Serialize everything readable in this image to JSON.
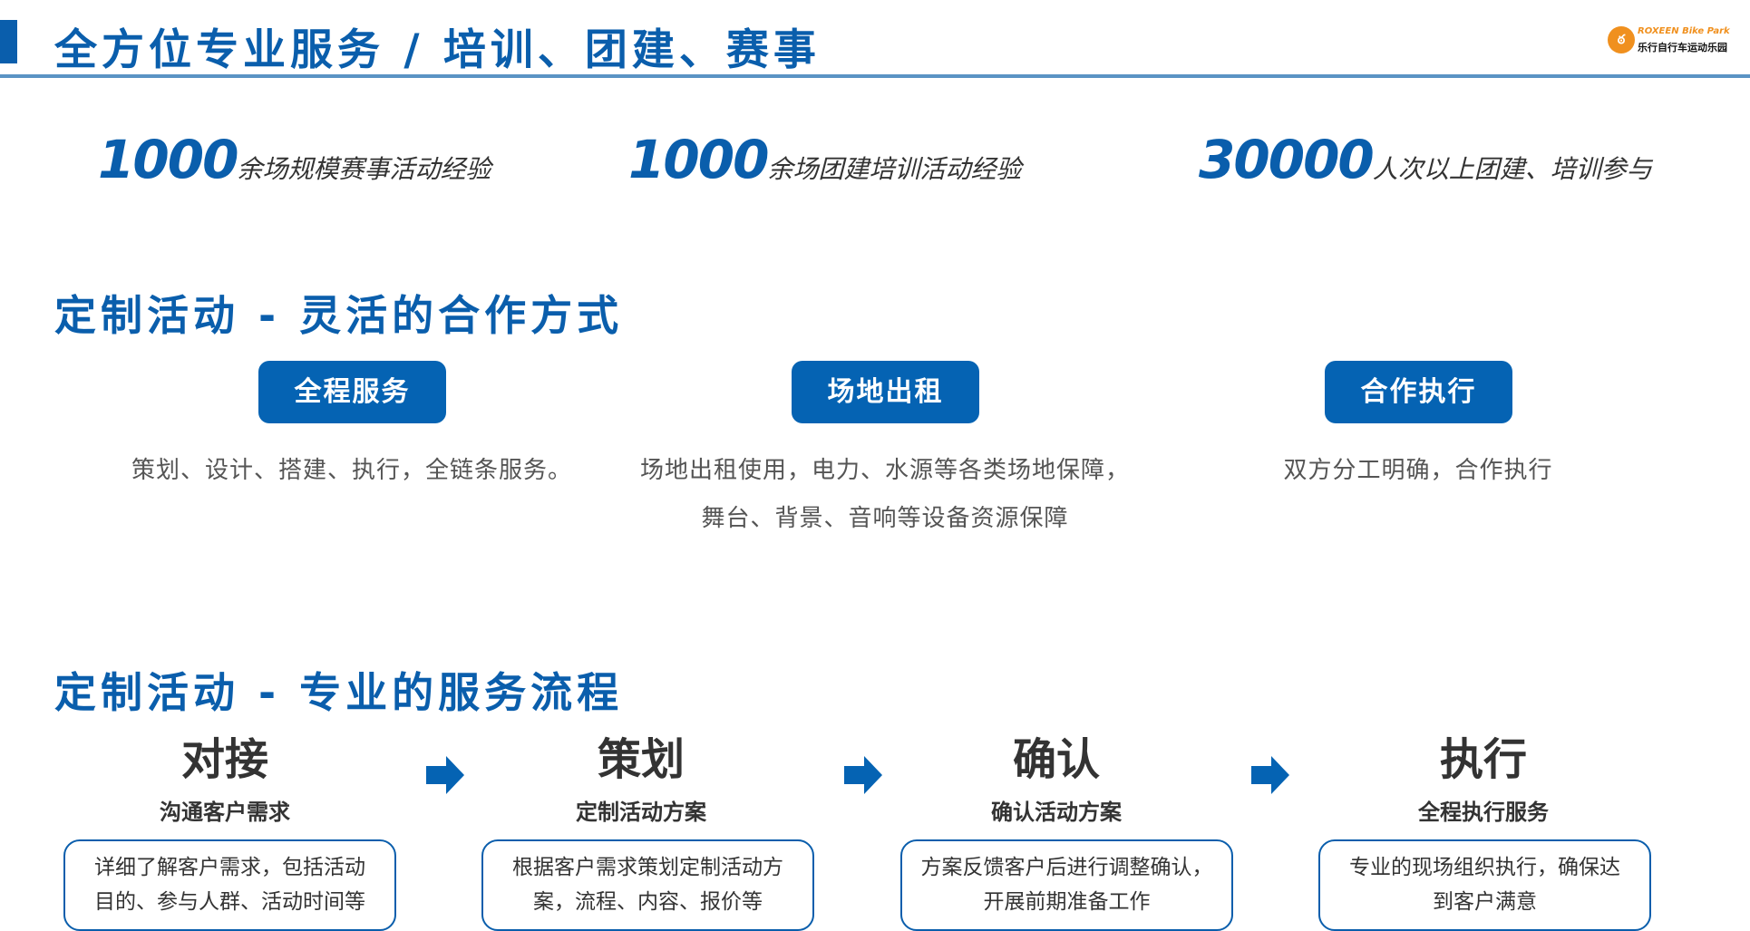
{
  "header": {
    "title": "全方位专业服务 / 培训、团建、赛事",
    "logo_en": "ROXEEN Bike Park",
    "logo_cn": "乐行自行车运动乐园"
  },
  "stats": [
    {
      "number": "1000",
      "label": "余场规模赛事活动经验"
    },
    {
      "number": "1000",
      "label": "余场团建培训活动经验"
    },
    {
      "number": "30000",
      "label": "人次以上团建、培训参与"
    }
  ],
  "cooperation": {
    "heading": "定制活动 - 灵活的合作方式",
    "items": [
      {
        "button": "全程服务",
        "desc": [
          "策划、设计、搭建、执行，全链条服务。"
        ]
      },
      {
        "button": "场地出租",
        "desc": [
          "场地出租使用，电力、水源等各类场地保障，",
          "舞台、背景、音响等设备资源保障"
        ]
      },
      {
        "button": "合作执行",
        "desc": [
          "双方分工明确，合作执行"
        ]
      }
    ]
  },
  "process": {
    "heading": "定制活动 - 专业的服务流程",
    "steps": [
      {
        "title": "对接",
        "subtitle": "沟通客户需求",
        "desc": [
          "详细了解客户需求，包括活动",
          "目的、参与人群、活动时间等"
        ]
      },
      {
        "title": "策划",
        "subtitle": "定制活动方案",
        "desc": [
          "根据客户需求策划定制活动方",
          "案，流程、内容、报价等"
        ]
      },
      {
        "title": "确认",
        "subtitle": "确认活动方案",
        "desc": [
          "方案反馈客户后进行调整确认，",
          "开展前期准备工作"
        ]
      },
      {
        "title": "执行",
        "subtitle": "全程执行服务",
        "desc": [
          "专业的现场组织执行，确保达",
          "到客户满意"
        ]
      }
    ]
  },
  "colors": {
    "brand": "#0a5eac",
    "button": "#0563b3",
    "logo": "#f0901e"
  }
}
